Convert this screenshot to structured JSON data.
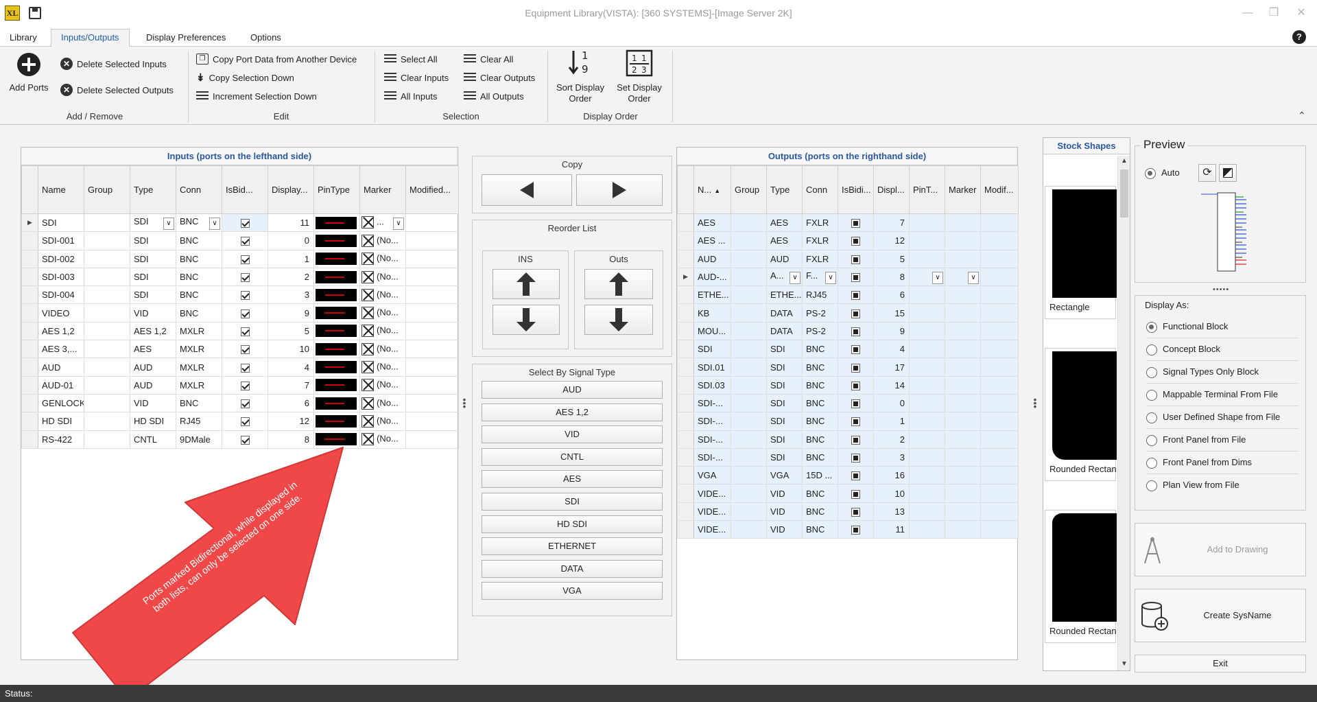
{
  "window": {
    "title": "Equipment Library(VISTA): [360 SYSTEMS]-[Image Server 2K]",
    "app_icon_text": "XL"
  },
  "menu": {
    "tabs": [
      "Library",
      "Inputs/Outputs",
      "Display Preferences",
      "Options"
    ],
    "active": "Inputs/Outputs",
    "help": "?"
  },
  "ribbon": {
    "add_remove": {
      "label": "Add / Remove",
      "add_ports": "Add Ports",
      "delete_inputs": "Delete Selected Inputs",
      "delete_outputs": "Delete Selected Outputs"
    },
    "edit": {
      "label": "Edit",
      "copy_port_data": "Copy Port Data from Another Device",
      "copy_selection_down": "Copy Selection Down",
      "increment_selection_down": "Increment Selection Down"
    },
    "selection": {
      "label": "Selection",
      "select_all": "Select All",
      "clear_inputs": "Clear Inputs",
      "all_inputs": "All Inputs",
      "clear_all": "Clear All",
      "clear_outputs": "Clear Outputs",
      "all_outputs": "All Outputs"
    },
    "display_order": {
      "label": "Display Order",
      "sort_line1": "Sort Display",
      "sort_line2": "Order",
      "set_line1": "Set Display",
      "set_line2": "Order"
    }
  },
  "inputs": {
    "title": "Inputs (ports on the lefthand side)",
    "columns": [
      "Name",
      "Group",
      "Type",
      "Conn",
      "IsBid...",
      "Display...",
      "PinType",
      "Marker",
      "Modified..."
    ],
    "rows": [
      {
        "name": "SDI",
        "group": "",
        "type": "SDI",
        "conn": "BNC",
        "display": "11",
        "marker": "..."
      },
      {
        "name": "SDI-001",
        "group": "",
        "type": "SDI",
        "conn": "BNC",
        "display": "0",
        "marker": "(No..."
      },
      {
        "name": "SDI-002",
        "group": "",
        "type": "SDI",
        "conn": "BNC",
        "display": "1",
        "marker": "(No..."
      },
      {
        "name": "SDI-003",
        "group": "",
        "type": "SDI",
        "conn": "BNC",
        "display": "2",
        "marker": "(No..."
      },
      {
        "name": "SDI-004",
        "group": "",
        "type": "SDI",
        "conn": "BNC",
        "display": "3",
        "marker": "(No..."
      },
      {
        "name": "VIDEO",
        "group": "",
        "type": "VID",
        "conn": "BNC",
        "display": "9",
        "marker": "(No..."
      },
      {
        "name": "AES 1,2",
        "group": "",
        "type": "AES 1,2",
        "conn": "MXLR",
        "display": "5",
        "marker": "(No..."
      },
      {
        "name": "AES 3,...",
        "group": "",
        "type": "AES",
        "conn": "MXLR",
        "display": "10",
        "marker": "(No..."
      },
      {
        "name": "AUD",
        "group": "",
        "type": "AUD",
        "conn": "MXLR",
        "display": "4",
        "marker": "(No..."
      },
      {
        "name": "AUD-01",
        "group": "",
        "type": "AUD",
        "conn": "MXLR",
        "display": "7",
        "marker": "(No..."
      },
      {
        "name": "GENLOCK",
        "group": "",
        "type": "VID",
        "conn": "BNC",
        "display": "6",
        "marker": "(No..."
      },
      {
        "name": "HD SDI",
        "group": "",
        "type": "HD SDI",
        "conn": "RJ45",
        "display": "12",
        "marker": "(No..."
      },
      {
        "name": "RS-422",
        "group": "",
        "type": "CNTL",
        "conn": "9DMale",
        "display": "8",
        "marker": "(No..."
      }
    ]
  },
  "middle": {
    "copy_label": "Copy",
    "reorder_label": "Reorder List",
    "ins_label": "INS",
    "outs_label": "Outs",
    "signal_label": "Select By Signal Type",
    "signal_types": [
      "AUD",
      "AES 1,2",
      "VID",
      "CNTL",
      "AES",
      "SDI",
      "HD SDI",
      "ETHERNET",
      "DATA",
      "VGA"
    ]
  },
  "outputs": {
    "title": "Outputs (ports on the righthand side)",
    "columns": [
      "N...",
      "Group",
      "Type",
      "Conn",
      "IsBidi...",
      "Displ...",
      "PinT...",
      "Marker",
      "Modif..."
    ],
    "rows": [
      {
        "name": "AES",
        "type": "AES",
        "conn": "FXLR",
        "display": "7"
      },
      {
        "name": "AES ...",
        "type": "AES",
        "conn": "FXLR",
        "display": "12"
      },
      {
        "name": "AUD",
        "type": "AUD",
        "conn": "FXLR",
        "display": "5"
      },
      {
        "name": "AUD-...",
        "type": "A...",
        "conn": "F...",
        "display": "8"
      },
      {
        "name": "ETHE...",
        "type": "ETHE...",
        "conn": "RJ45",
        "display": "6"
      },
      {
        "name": "KB",
        "type": "DATA",
        "conn": "PS-2",
        "display": "15"
      },
      {
        "name": "MOU...",
        "type": "DATA",
        "conn": "PS-2",
        "display": "9"
      },
      {
        "name": "SDI",
        "type": "SDI",
        "conn": "BNC",
        "display": "4"
      },
      {
        "name": "SDI.01",
        "type": "SDI",
        "conn": "BNC",
        "display": "17"
      },
      {
        "name": "SDI.03",
        "type": "SDI",
        "conn": "BNC",
        "display": "14"
      },
      {
        "name": "SDI-...",
        "type": "SDI",
        "conn": "BNC",
        "display": "0"
      },
      {
        "name": "SDI-...",
        "type": "SDI",
        "conn": "BNC",
        "display": "1"
      },
      {
        "name": "SDI-...",
        "type": "SDI",
        "conn": "BNC",
        "display": "2"
      },
      {
        "name": "SDI-...",
        "type": "SDI",
        "conn": "BNC",
        "display": "3"
      },
      {
        "name": "VGA",
        "type": "VGA",
        "conn": "15D ...",
        "display": "16"
      },
      {
        "name": "VIDE...",
        "type": "VID",
        "conn": "BNC",
        "display": "10"
      },
      {
        "name": "VIDE...",
        "type": "VID",
        "conn": "BNC",
        "display": "13"
      },
      {
        "name": "VIDE...",
        "type": "VID",
        "conn": "BNC",
        "display": "11"
      }
    ]
  },
  "stock_shapes": {
    "title": "Stock Shapes",
    "items": [
      "Rectangle",
      "Rounded Rectan",
      "Rounded Rectan"
    ]
  },
  "preview": {
    "title": "Preview",
    "auto_label": "Auto",
    "display_as_label": "Display As:",
    "options": [
      "Functional Block",
      "Concept Block",
      "Signal Types Only Block",
      "Mappable Terminal From File",
      "User Defined Shape from File",
      "Front Panel from File",
      "Front Panel from Dims",
      "Plan View from File"
    ],
    "selected": "Functional Block",
    "add_to_drawing": "Add to Drawing",
    "create_sysname": "Create SysName",
    "exit": "Exit"
  },
  "annotation": {
    "text": "Ports marked Bidirectional, while displayed in both lists, can only be selected on one side.",
    "color": "#f04848"
  },
  "status": {
    "label": "Status:"
  }
}
